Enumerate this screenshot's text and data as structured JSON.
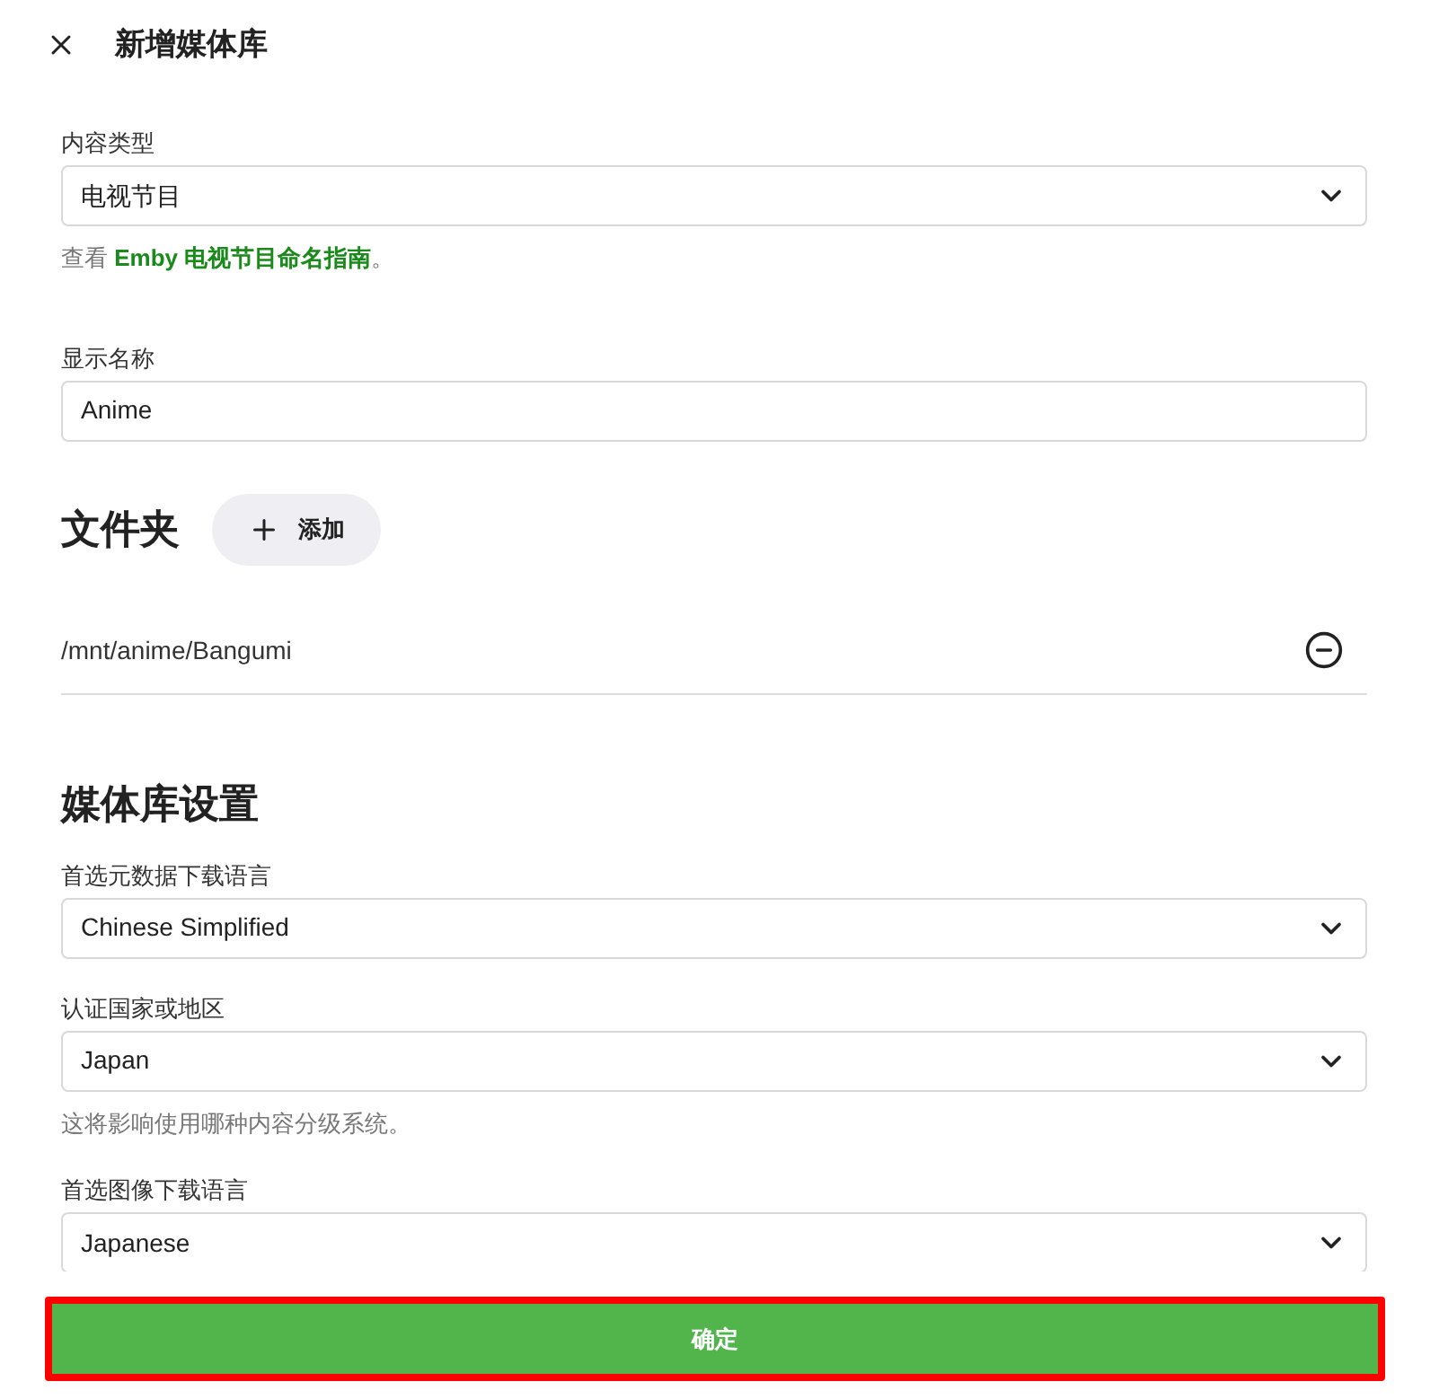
{
  "header": {
    "title": "新增媒体库"
  },
  "basic_fields": [
    {
      "kind": "select",
      "label": "内容类型",
      "value": "电视节目",
      "help": {
        "prefix": "查看",
        "link": "Emby 电视节目命名指南",
        "suffix": "。"
      }
    },
    {
      "kind": "text",
      "label": "显示名称",
      "value": "Anime"
    }
  ],
  "folders": {
    "title": "文件夹",
    "add_button": "添加",
    "items": [
      {
        "path": "/mnt/anime/Bangumi"
      }
    ]
  },
  "library_settings": {
    "title": "媒体库设置",
    "fields": [
      {
        "kind": "select",
        "label": "首选元数据下载语言",
        "value": "Chinese Simplified"
      },
      {
        "kind": "select",
        "label": "认证国家或地区",
        "value": "Japan",
        "help": {
          "prefix": "这将影响使用哪种内容分级系统。"
        }
      },
      {
        "kind": "select",
        "label": "首选图像下载语言",
        "value": "Japanese"
      }
    ]
  },
  "confirm_button": {
    "label": "确定",
    "highlighted": true
  }
}
